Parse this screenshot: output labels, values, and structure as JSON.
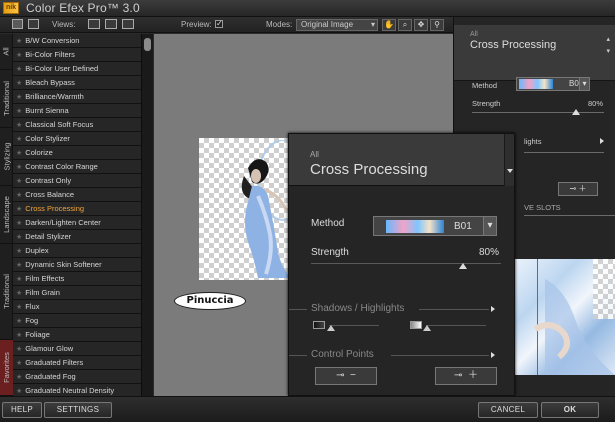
{
  "app": {
    "logo_text": "nik",
    "title": "Color Efex Pro™ 3.0"
  },
  "toolbar": {
    "views_label": "Views:",
    "preview_label": "Preview:",
    "preview_checked": "✓",
    "modes_label": "Modes:",
    "mode_value": "Original Image"
  },
  "categories": [
    "All",
    "Traditional",
    "Stylizing",
    "Landscape",
    "Traditional",
    "Favorites"
  ],
  "filters": [
    "B/W Conversion",
    "Bi-Color Filters",
    "Bi-Color User Defined",
    "Bleach Bypass",
    "Brilliance/Warmth",
    "Burnt Sienna",
    "Classical Soft Focus",
    "Color Stylizer",
    "Colorize",
    "Contrast Color Range",
    "Contrast Only",
    "Cross Balance",
    "Cross Processing",
    "Darken/Lighten Center",
    "Detail Stylizer",
    "Duplex",
    "Dynamic Skin Softener",
    "Film Effects",
    "Film Grain",
    "Flux",
    "Fog",
    "Foliage",
    "Glamour Glow",
    "Graduated Filters",
    "Graduated Fog",
    "Graduated Neutral Density"
  ],
  "active_filter": "Cross Processing",
  "watermark": "Pinuccia",
  "panel": {
    "category": "All",
    "filter_name": "Cross Processing",
    "method_label": "Method",
    "method_value": "B01",
    "strength_label": "Strength",
    "strength_value": "80%",
    "strength_fraction": 0.8,
    "shadows_highlights_label": "Shadows / Highlights",
    "control_points_label": "Control Points",
    "slots_label": "VE SLOTS"
  },
  "right_panel": {
    "category": "All",
    "filter_name": "Cross Processing",
    "method_label": "Method",
    "method_value": "B01",
    "strength_label": "Strength",
    "strength_value": "80%",
    "highlights_label": "lights"
  },
  "buttons": {
    "help": "HELP",
    "settings": "SETTINGS",
    "cancel": "CANCEL",
    "ok": "OK"
  },
  "colors": {
    "accent": "#f2a43a",
    "loupe_line": "#e2383d"
  }
}
